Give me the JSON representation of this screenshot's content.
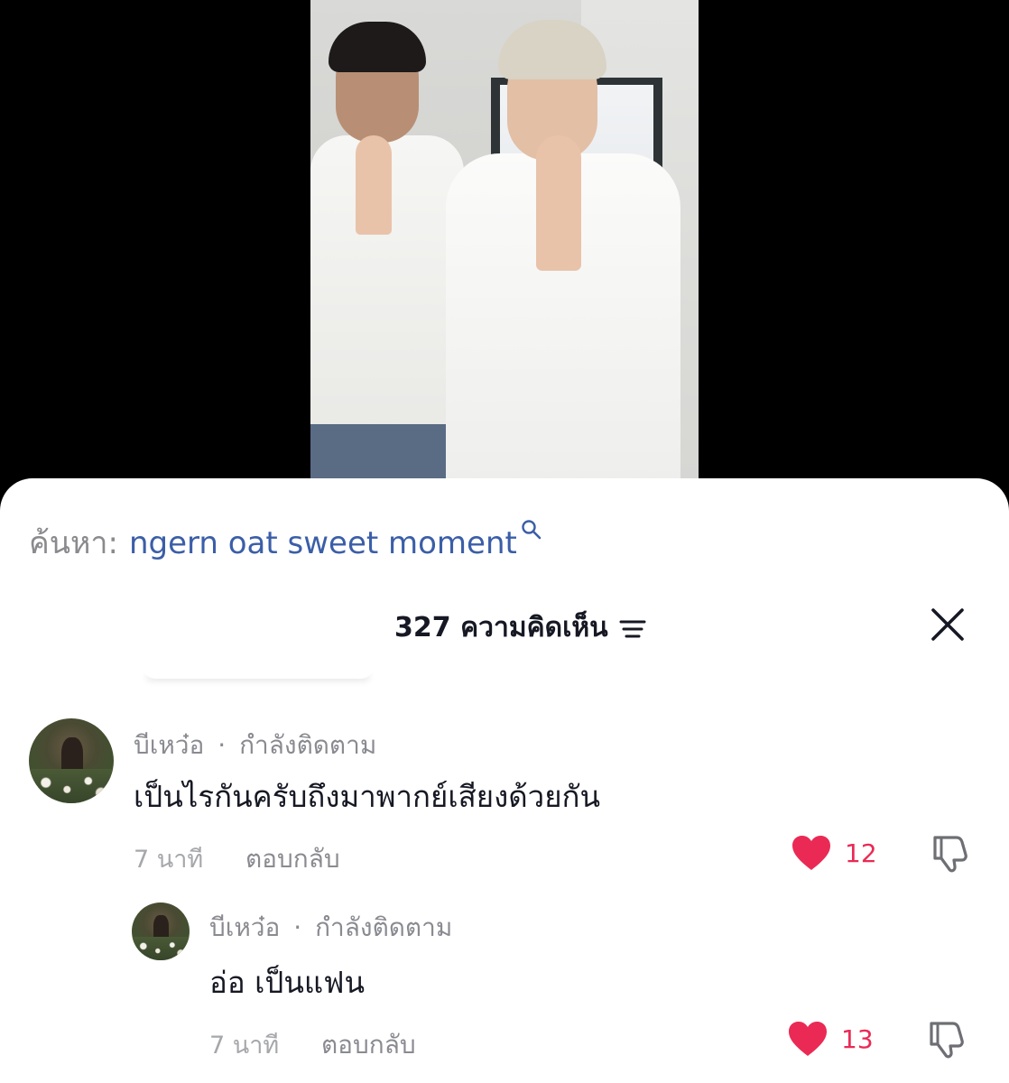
{
  "search": {
    "prefix": "ค้นหา:",
    "query": "ngern oat sweet moment",
    "icon": "search-icon"
  },
  "comments_header": {
    "count_label": "327 ความคิดเห็น",
    "filter_icon": "filter-icon",
    "close_icon": "close-icon"
  },
  "colors": {
    "accent_link": "#3b5ea8",
    "like_red": "#ea2a55",
    "text_primary": "#161823",
    "text_secondary": "#8a8b91"
  },
  "comments": [
    {
      "author": "บีเหว๋อ",
      "status": "กำลังติดตาม",
      "separator": "·",
      "text": "เป็นไรกันครับถึงมาพากย์เสียงด้วยกัน",
      "time": "7 นาที",
      "reply_label": "ตอบกลับ",
      "likes": "12",
      "liked": true
    },
    {
      "author": "บีเหว๋อ",
      "status": "กำลังติดตาม",
      "separator": "·",
      "text": "อ่อ เป็นแฟน",
      "time": "7 นาที",
      "reply_label": "ตอบกลับ",
      "likes": "13",
      "liked": true
    }
  ]
}
